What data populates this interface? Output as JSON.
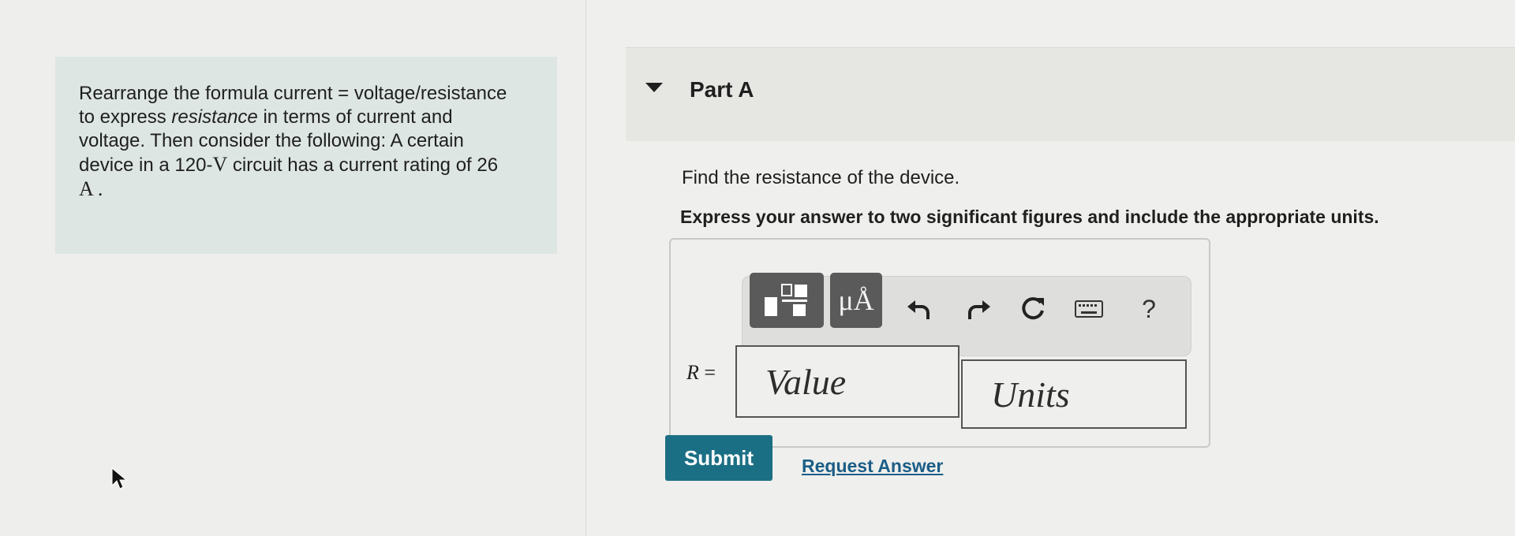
{
  "intro": {
    "line1": "Rearrange the formula current = voltage/resistance",
    "line2_pre": "to express ",
    "line2_em": "resistance",
    "line2_post": " in terms of current and",
    "line3": "voltage. Then consider the following: A certain",
    "line4_pre": "device in a 120-",
    "line4_unit": "V",
    "line4_post": " circuit has a current rating of 26",
    "line5": "A ."
  },
  "part": {
    "title": "Part A"
  },
  "question": {
    "text": "Find the resistance of the device.",
    "instruction": "Express your answer to two significant figures and include the appropriate units."
  },
  "toolbar": {
    "units_button_label": "μÅ",
    "help_label": "?",
    "icons": [
      "templates-icon",
      "units-icon",
      "undo-icon",
      "redo-icon",
      "reset-icon",
      "keyboard-icon",
      "help-icon"
    ]
  },
  "answer": {
    "variable": "R",
    "equals": "=",
    "value_placeholder": "Value",
    "units_placeholder": "Units"
  },
  "actions": {
    "submit_label": "Submit",
    "request_answer_label": "Request Answer"
  },
  "colors": {
    "intro_background": "#dde6e2",
    "submit_background": "#1b6f84",
    "link": "#1b5d86",
    "toolbar_button": "#5a5a5a"
  }
}
